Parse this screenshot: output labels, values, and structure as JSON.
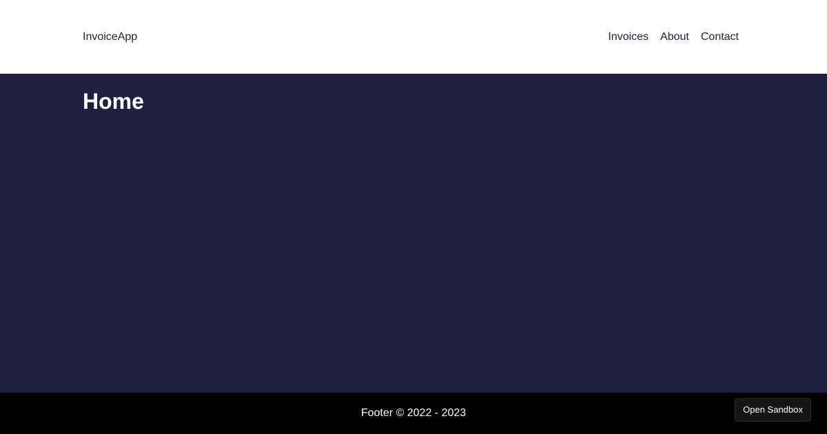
{
  "header": {
    "brand": "InvoiceApp",
    "nav": [
      {
        "label": "Invoices"
      },
      {
        "label": "About"
      },
      {
        "label": "Contact"
      }
    ]
  },
  "main": {
    "title": "Home"
  },
  "footer": {
    "text": "Footer © 2022 - 2023"
  },
  "sandbox_button": {
    "label": "Open Sandbox"
  },
  "colors": {
    "header_bg": "#ffffff",
    "main_bg": "#202040",
    "footer_bg": "#000000",
    "text_dark": "#202040",
    "text_light": "#ffffff"
  }
}
